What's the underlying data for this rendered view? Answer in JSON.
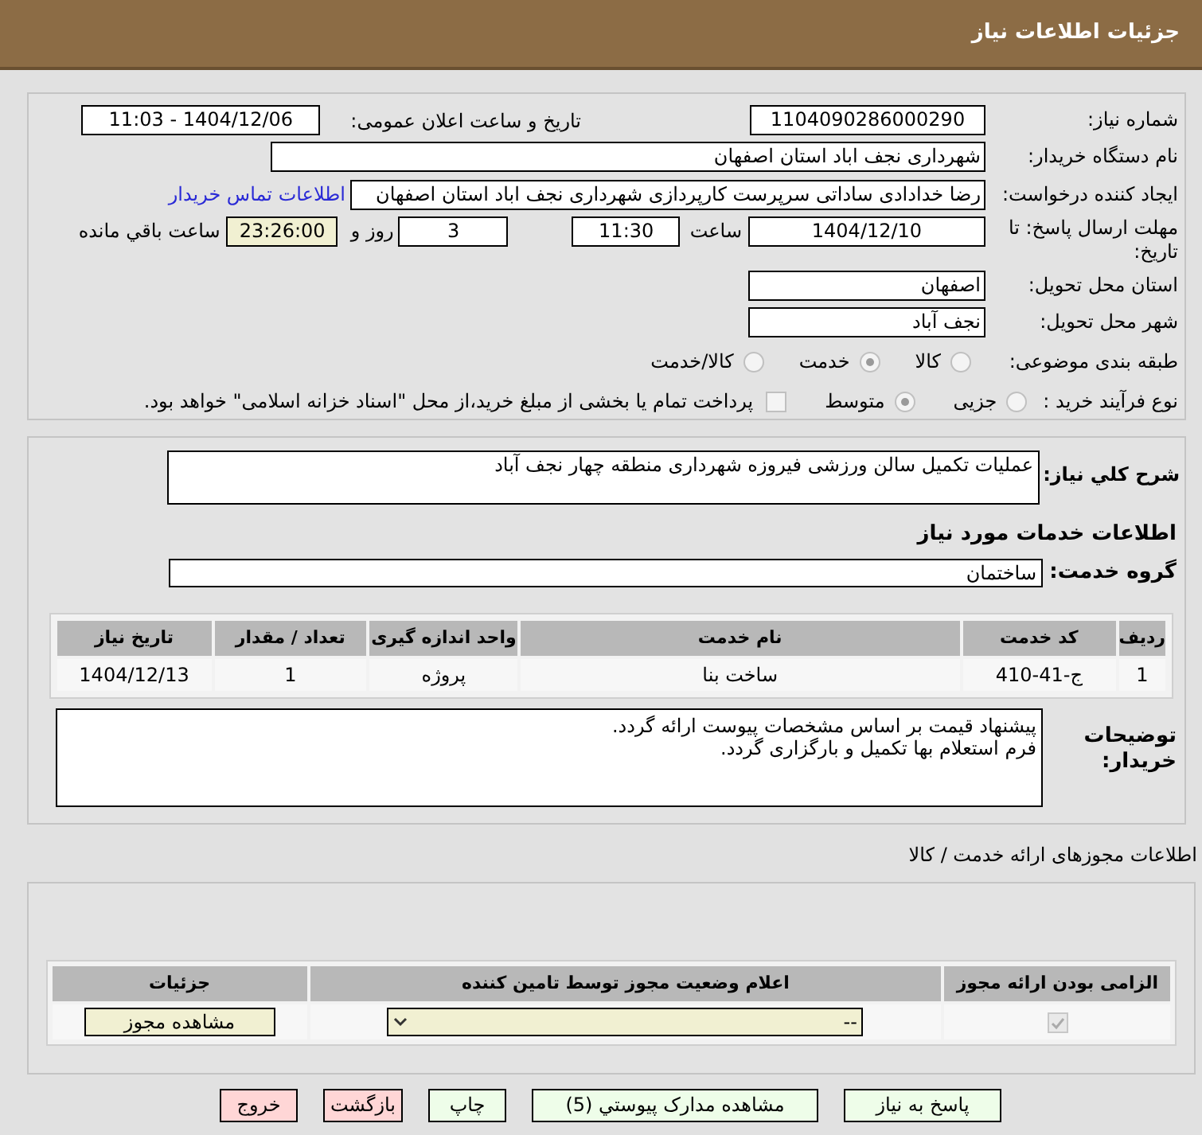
{
  "header": {
    "title": "جزئیات اطلاعات نیاز"
  },
  "need_info": {
    "need_number": {
      "label": "شماره نیاز:",
      "value": "1104090286000290"
    },
    "announce": {
      "label": "تاریخ و ساعت اعلان عمومی:",
      "value": "1404/12/06 - 11:03"
    },
    "buyer": {
      "label": "نام دستگاه خریدار:",
      "value": "شهرداری نجف اباد استان اصفهان"
    },
    "creator": {
      "label": "ایجاد کننده درخواست:",
      "value": "رضا خدادادی ساداتی سرپرست  کارپردازی شهرداری نجف اباد استان اصفهان",
      "link": "اطلاعات تماس خریدار"
    },
    "deadline": {
      "label": "مهلت ارسال پاسخ: تا تاریخ:",
      "date": "1404/12/10",
      "time_label": "ساعت",
      "time": "11:30",
      "days": "3",
      "days_label": "روز و",
      "remaining": "23:26:00",
      "remaining_label": "ساعت باقي مانده"
    },
    "province": {
      "label": "استان محل تحویل:",
      "value": "اصفهان"
    },
    "city": {
      "label": "شهر محل تحویل:",
      "value": "نجف آباد"
    },
    "category": {
      "label": "طبقه بندی موضوعی:",
      "options": [
        {
          "label": "کالا",
          "selected": false
        },
        {
          "label": "خدمت",
          "selected": true
        },
        {
          "label": "کالا/خدمت",
          "selected": false
        }
      ]
    },
    "process": {
      "label": "نوع فرآیند خرید :",
      "options": [
        {
          "label": "جزیی",
          "selected": false
        },
        {
          "label": "متوسط",
          "selected": true
        }
      ],
      "payment": {
        "checked": false,
        "text": "پرداخت تمام یا بخشی از مبلغ خرید،از محل \"اسناد خزانه اسلامی\" خواهد بود."
      }
    }
  },
  "services": {
    "description": {
      "label": "شرح کلي نياز:",
      "value": "عملیات تکمیل سالن ورزشی فیروزه شهرداری منطقه چهار نجف آباد"
    },
    "title": "اطلاعات خدمات مورد نیاز",
    "group": {
      "label": "گروه خدمت:",
      "value": "ساختمان"
    },
    "table": {
      "columns": [
        "ردیف",
        "کد خدمت",
        "نام خدمت",
        "واحد اندازه گیری",
        "تعداد / مقدار",
        "تاریخ نیاز"
      ],
      "rows": [
        [
          "1",
          "ج-41-410",
          "ساخت بنا",
          "پروژه",
          "1",
          "1404/12/13"
        ]
      ]
    },
    "notes": {
      "label": "توضیحات خریدار:",
      "lines": [
        "پیشنهاد قیمت بر اساس مشخصات پیوست ارائه گردد.",
        "فرم استعلام بها تکمیل و بارگزاری گردد."
      ]
    }
  },
  "licenses": {
    "title": "اطلاعات مجوزهای ارائه خدمت / کالا",
    "columns": [
      "الزامی بودن ارائه مجوز",
      "اعلام وضعیت مجوز توسط تامین کننده",
      "جزئیات"
    ],
    "rows": [
      {
        "required": true,
        "status": "--",
        "button": "مشاهده مجوز"
      }
    ]
  },
  "buttons": [
    {
      "label": "پاسخ به نیاز",
      "kind": "normal"
    },
    {
      "label": "مشاهده مدارک پیوستي (5)",
      "kind": "normal"
    },
    {
      "label": "چاپ",
      "kind": "normal"
    },
    {
      "label": "بازگشت",
      "kind": "danger"
    },
    {
      "label": "خروج",
      "kind": "danger"
    }
  ]
}
